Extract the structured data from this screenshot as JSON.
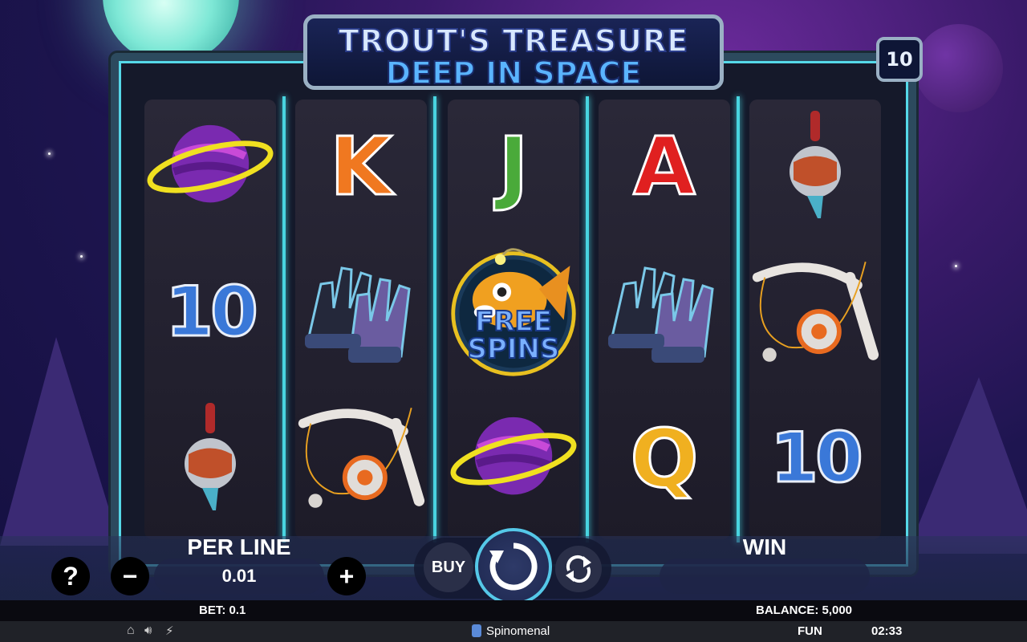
{
  "title": {
    "line1": "TROUT'S TREASURE",
    "line2": "DEEP IN SPACE"
  },
  "paylines": "10",
  "reels": [
    {
      "symbols": [
        "planet-icon",
        "10",
        "bobber-icon"
      ]
    },
    {
      "symbols": [
        "K",
        "gloves-icon",
        "fishing-rod-icon"
      ]
    },
    {
      "symbols": [
        "J",
        "free-spins-fish-icon",
        "planet-icon"
      ]
    },
    {
      "symbols": [
        "A",
        "gloves-icon",
        "Q"
      ]
    },
    {
      "symbols": [
        "bobber-icon",
        "fishing-rod-icon",
        "10"
      ]
    }
  ],
  "symbol_text": {
    "ten": "10",
    "k": "K",
    "j": "J",
    "a": "A",
    "q": "Q",
    "free": "FREE",
    "spins": "SPINS"
  },
  "controls": {
    "help": "?",
    "per_line_label": "PER LINE",
    "per_line_value": "0.01",
    "minus": "−",
    "plus": "+",
    "buy": "BUY",
    "win_label": "WIN",
    "win_value": ""
  },
  "info": {
    "bet": "BET: 0.1",
    "balance": "BALANCE: 5,000"
  },
  "footer": {
    "brand": "Spinomenal",
    "mode": "FUN",
    "time": "02:33"
  },
  "colors": {
    "accent": "#48d4e0",
    "letter_k": "#f07820",
    "letter_j": "#4aaa3a",
    "letter_a": "#e02020",
    "letter_q": "#f0b020"
  }
}
